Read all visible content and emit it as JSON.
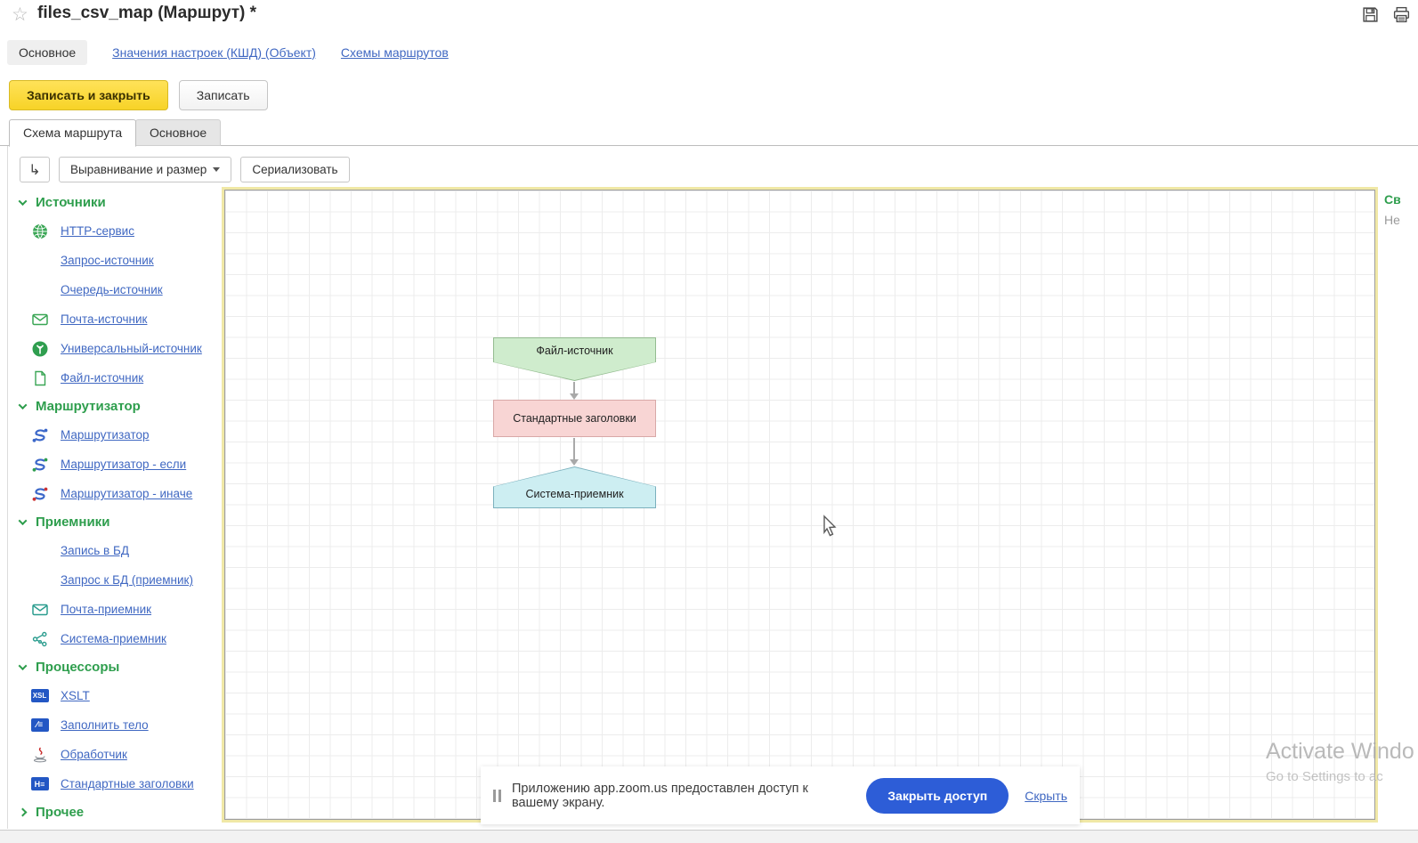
{
  "window": {
    "title": "files_csv_map (Маршрут) *",
    "star_icon": "☆"
  },
  "nav_tabs": [
    {
      "label": "Основное",
      "active": true
    },
    {
      "label": "Значения настроек (КШД) (Объект)",
      "active": false
    },
    {
      "label": "Схемы маршрутов",
      "active": false
    }
  ],
  "actions": {
    "save_close": "Записать и закрыть",
    "save": "Записать"
  },
  "page_tabs": [
    {
      "label": "Схема маршрута",
      "active": true
    },
    {
      "label": "Основное",
      "active": false
    }
  ],
  "toolbar": {
    "reroute_icon": "↳",
    "align_size": "Выравнивание и размер",
    "serialize": "Сериализовать"
  },
  "palette": {
    "sections": [
      {
        "label": "Источники",
        "expanded": true,
        "items": [
          {
            "label": "HTTP-сервис",
            "icon": "globe-icon"
          },
          {
            "label": "Запрос-источник",
            "icon": ""
          },
          {
            "label": "Очередь-источник",
            "icon": ""
          },
          {
            "label": "Почта-источник",
            "icon": "mail-icon"
          },
          {
            "label": "Универсальный-источник",
            "icon": "universal-source-icon"
          },
          {
            "label": "Файл-источник",
            "icon": "file-icon"
          }
        ]
      },
      {
        "label": "Маршрутизатор",
        "expanded": true,
        "items": [
          {
            "label": "Маршрутизатор",
            "icon": "router-icon"
          },
          {
            "label": "Маршрутизатор - если",
            "icon": "router-if-icon"
          },
          {
            "label": "Маршрутизатор - иначе",
            "icon": "router-else-icon"
          }
        ]
      },
      {
        "label": "Приемники",
        "expanded": true,
        "items": [
          {
            "label": "Запись в БД",
            "icon": ""
          },
          {
            "label": "Запрос к БД (приемник)",
            "icon": ""
          },
          {
            "label": "Почта-приемник",
            "icon": "mail-icon"
          },
          {
            "label": "Система-приемник",
            "icon": "system-network-icon"
          }
        ]
      },
      {
        "label": "Процессоры",
        "expanded": true,
        "items": [
          {
            "label": "XSLT",
            "icon": "xsl-badge-icon"
          },
          {
            "label": "Заполнить тело",
            "icon": "fill-body-badge-icon"
          },
          {
            "label": "Обработчик",
            "icon": "java-icon"
          },
          {
            "label": "Стандартные заголовки",
            "icon": "headers-badge-icon"
          }
        ]
      },
      {
        "label": "Прочее",
        "expanded": false,
        "items": []
      }
    ]
  },
  "badges": {
    "xsl": "XSL",
    "fill_body": "∕≡",
    "headers": "H≡"
  },
  "canvas": {
    "nodes": [
      {
        "label": "Файл-источник",
        "type": "source",
        "fill": "#cfeccd",
        "border": "#94bc90"
      },
      {
        "label": "Стандартные заголовки",
        "type": "processor",
        "fill": "#f8d5d4",
        "border": "#d8a8a7"
      },
      {
        "label": "Система-приемник",
        "type": "sink",
        "fill": "#cdeef2",
        "border": "#7bb0bd"
      }
    ],
    "properties_panel": {
      "title_truncated": "Св",
      "subtitle_truncated": "Не"
    }
  },
  "watermark": {
    "line1": "Activate Windo",
    "line2": "Go to Settings to ac"
  },
  "notification": {
    "message": "Приложению app.zoom.us предоставлен доступ к вашему экрану.",
    "close_button": "Закрыть доступ",
    "hide_link": "Скрыть"
  },
  "colors": {
    "accent_green": "#2e9e4d",
    "link_blue": "#4068c2",
    "primary_button_yellow": "#f7d327",
    "canvas_focus_yellow": "#f0e8a6",
    "notification_blue": "#2d5dd7"
  }
}
